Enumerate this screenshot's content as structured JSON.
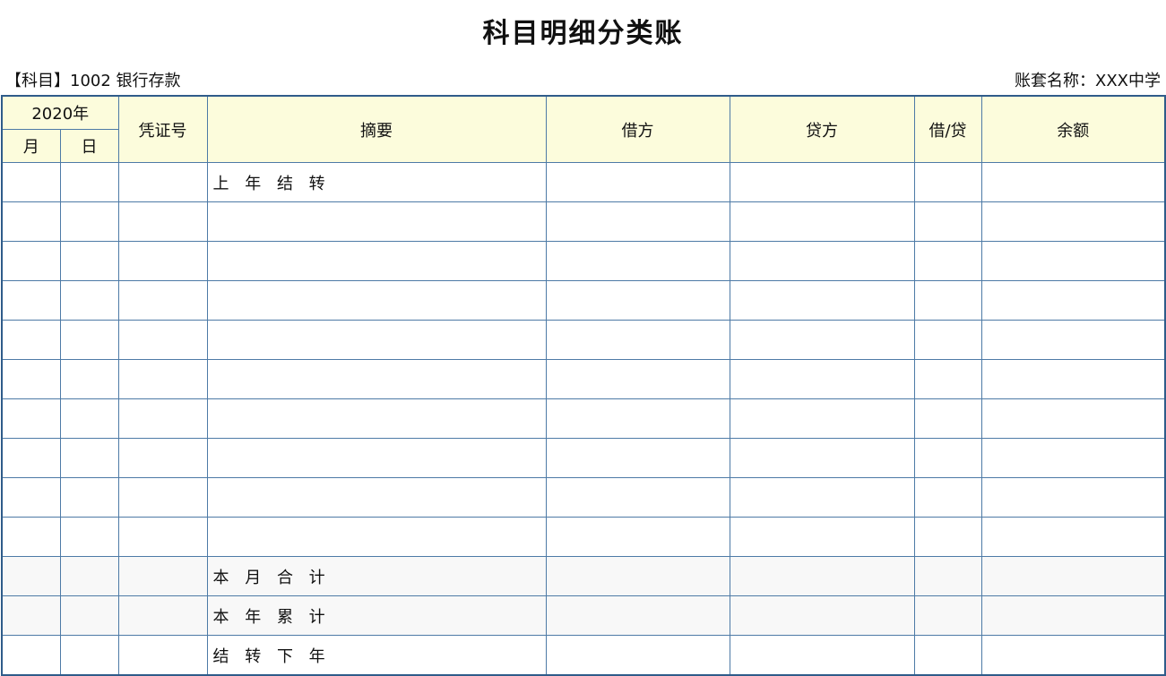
{
  "title": "科目明细分类账",
  "subject_label": "【科目】1002 银行存款",
  "account_set_label": "账套名称：XXX中学",
  "headers": {
    "year": "2020年",
    "month": "月",
    "day": "日",
    "voucher_no": "凭证号",
    "summary": "摘要",
    "debit": "借方",
    "credit": "贷方",
    "debit_credit": "借/贷",
    "balance": "余额"
  },
  "rows": [
    {
      "summary": "上 年 结 转"
    },
    {
      "summary": ""
    },
    {
      "summary": ""
    },
    {
      "summary": ""
    },
    {
      "summary": ""
    },
    {
      "summary": ""
    },
    {
      "summary": ""
    },
    {
      "summary": ""
    },
    {
      "summary": ""
    },
    {
      "summary": ""
    },
    {
      "summary": "本 月 合 计"
    },
    {
      "summary": "本 年 累 计"
    },
    {
      "summary": "结 转 下 年"
    }
  ],
  "colors": {
    "header_bg": "#fcfcdc",
    "border": "#2f5c8a",
    "summary_row_bg": "#f8f8f8"
  }
}
